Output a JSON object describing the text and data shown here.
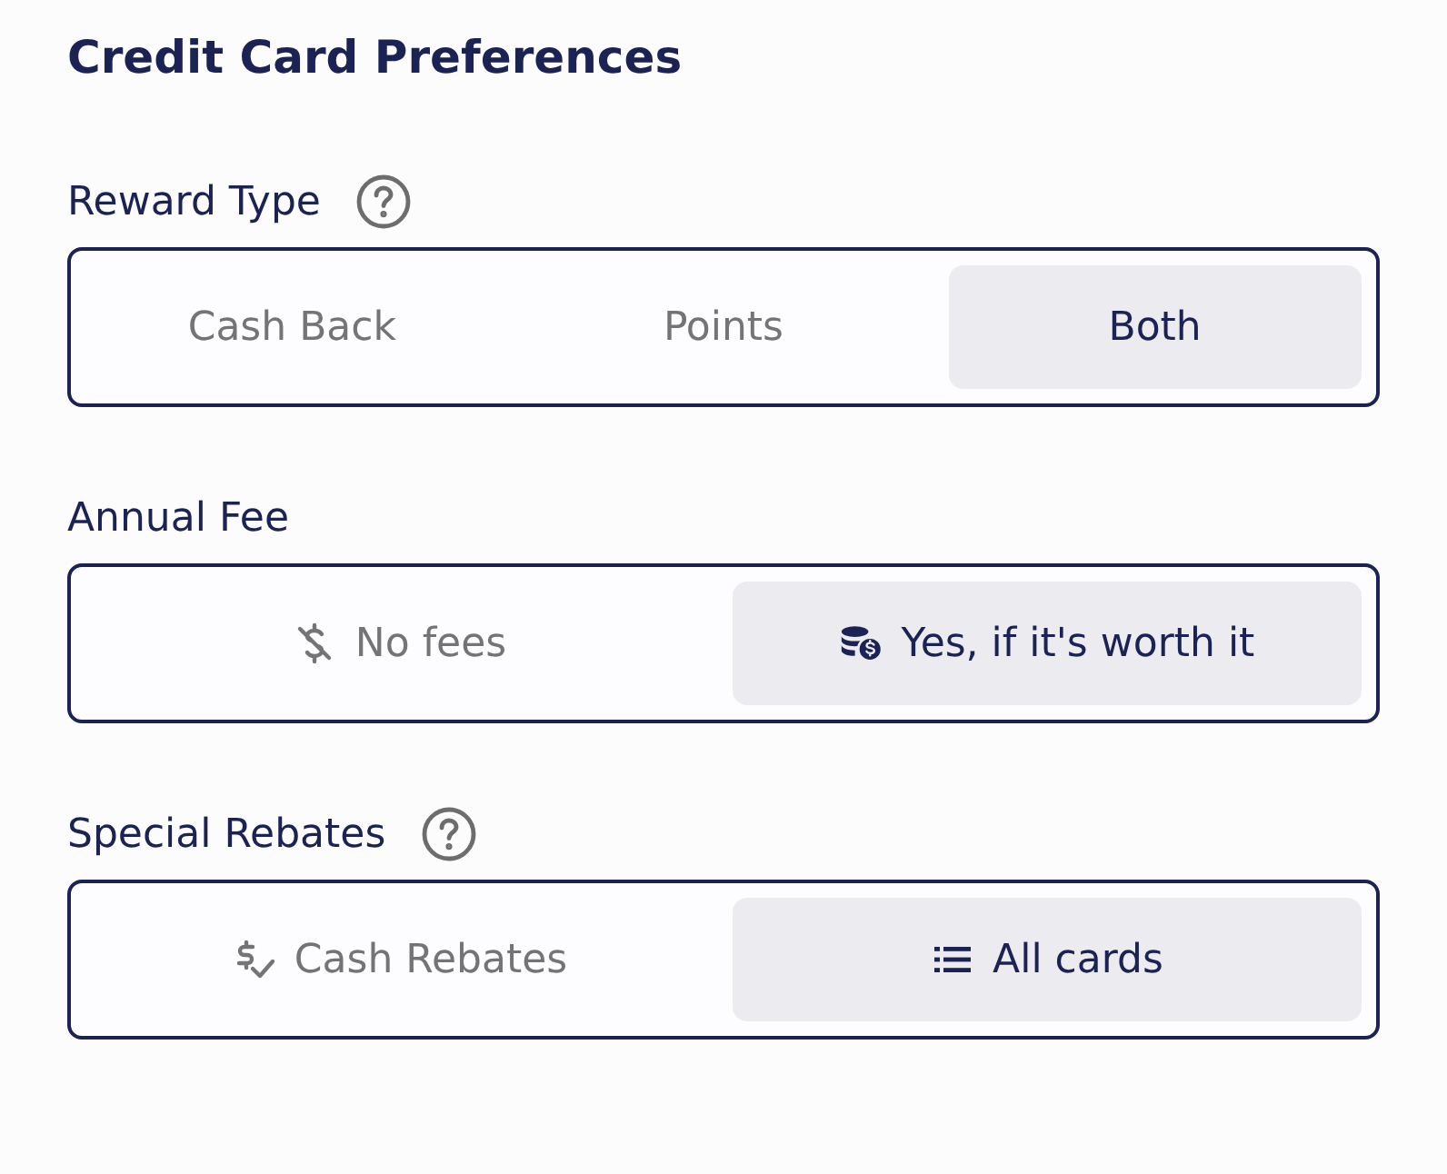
{
  "title": "Credit Card Preferences",
  "groups": [
    {
      "label": "Reward Type",
      "help": true,
      "options": [
        {
          "label": "Cash Back",
          "selected": false
        },
        {
          "label": "Points",
          "selected": false
        },
        {
          "label": "Both",
          "selected": true
        }
      ]
    },
    {
      "label": "Annual Fee",
      "help": false,
      "options": [
        {
          "label": "No fees",
          "selected": false,
          "kind": "dollar-off"
        },
        {
          "label": "Yes, if it's worth it",
          "selected": true,
          "kind": "coins"
        }
      ]
    },
    {
      "label": "Special Rebates",
      "help": true,
      "options": [
        {
          "label": "Cash Rebates",
          "selected": false,
          "kind": "dollar-check"
        },
        {
          "label": "All cards",
          "selected": true,
          "kind": "list"
        }
      ]
    }
  ]
}
